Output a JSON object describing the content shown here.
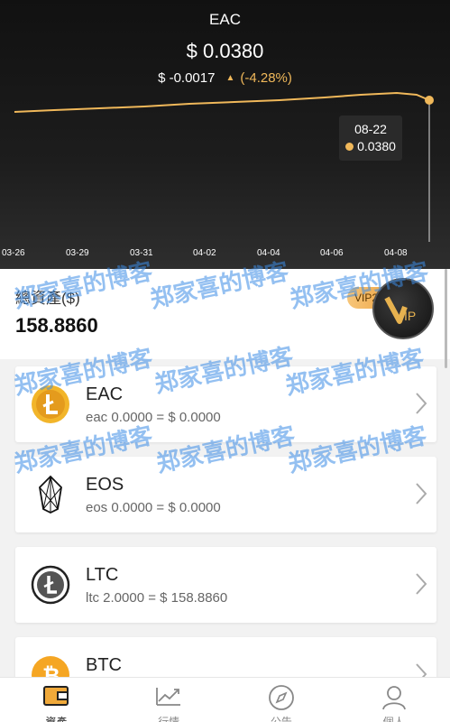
{
  "chart": {
    "title": "EAC",
    "price": "$ 0.0380",
    "change_abs": "$ -0.0017",
    "change_pct": "(-4.28%)",
    "tooltip_date": "08-22",
    "tooltip_value": "0.0380",
    "x_ticks": [
      "03-26",
      "03-29",
      "03-31",
      "04-02",
      "04-04",
      "04-06",
      "04-08"
    ],
    "accent_color": "#f0b85a"
  },
  "summary": {
    "label": "總資產($)",
    "value": "158.8860",
    "vip_label": "VIP2",
    "vip_badge_letters": "VIP"
  },
  "coins": [
    {
      "name": "EAC",
      "detail": "eac 0.0000 = $ 0.0000",
      "icon": "eac-coin-icon"
    },
    {
      "name": "EOS",
      "detail": "eos 0.0000 = $ 0.0000",
      "icon": "eos-coin-icon"
    },
    {
      "name": "LTC",
      "detail": "ltc 2.0000 = $ 158.8860",
      "icon": "ltc-coin-icon"
    },
    {
      "name": "BTC",
      "detail": "",
      "icon": "btc-coin-icon"
    }
  ],
  "nav": [
    {
      "label": "資產",
      "icon": "wallet-icon"
    },
    {
      "label": "行情",
      "icon": "chart-icon"
    },
    {
      "label": "公告",
      "icon": "compass-icon"
    },
    {
      "label": "個人",
      "icon": "user-icon"
    }
  ],
  "watermark": "郑家喜的博客"
}
